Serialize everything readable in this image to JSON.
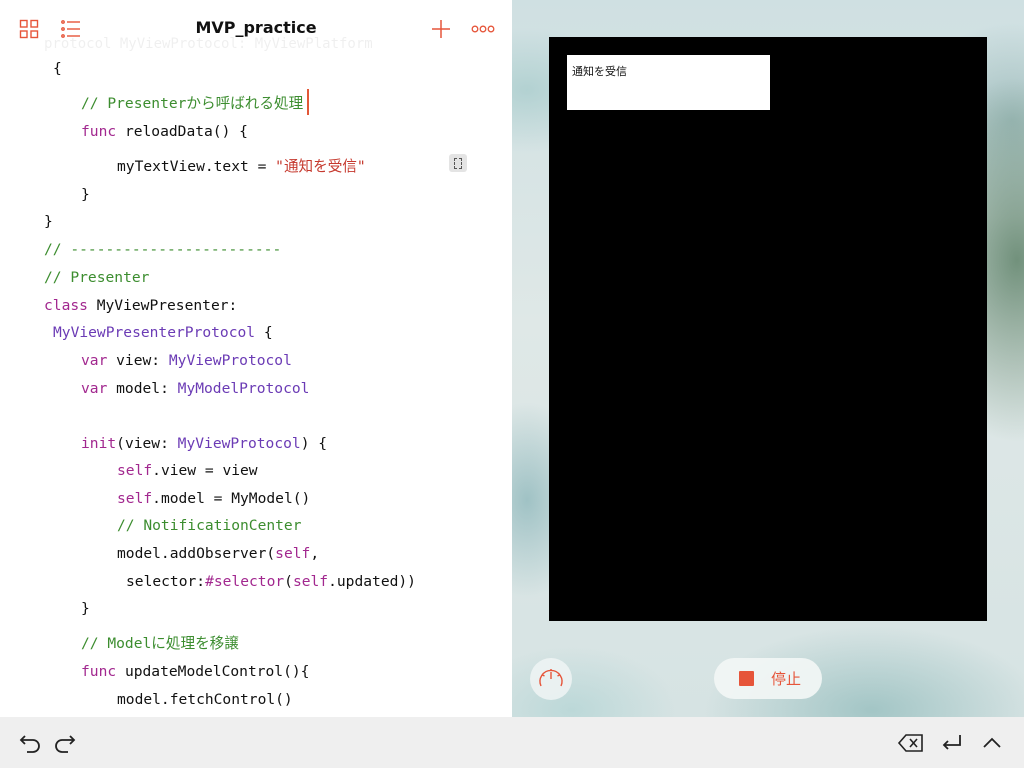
{
  "editor": {
    "title": "MVP_practice",
    "ghost_text": "protocol MyViewProtocol: MyViewPlatform",
    "lines": [
      [
        {
          "t": "{",
          "c": "pl"
        }
      ],
      [
        {
          "t": "// Presenterから呼ばれる処理",
          "c": "cm"
        }
      ],
      [
        {
          "t": "func",
          "c": "kw"
        },
        {
          "t": " reloadData() {",
          "c": "pl"
        }
      ],
      [
        {
          "t": "myTextView.text = ",
          "c": "pl"
        },
        {
          "t": "\"通知を受信\"",
          "c": "st"
        }
      ],
      [
        {
          "t": "}",
          "c": "pl"
        }
      ],
      [
        {
          "t": "}",
          "c": "pl"
        }
      ],
      [
        {
          "t": "// ------------------------",
          "c": "cm"
        }
      ],
      [
        {
          "t": "// Presenter",
          "c": "cm"
        }
      ],
      [
        {
          "t": "class",
          "c": "kw"
        },
        {
          "t": " MyViewPresenter:",
          "c": "pl"
        }
      ],
      [
        {
          "t": "MyViewPresenterProtocol",
          "c": "ty"
        },
        {
          "t": " {",
          "c": "pl"
        }
      ],
      [
        {
          "t": "var",
          "c": "kw"
        },
        {
          "t": " view: ",
          "c": "pl"
        },
        {
          "t": "MyViewProtocol",
          "c": "ty"
        }
      ],
      [
        {
          "t": "var",
          "c": "kw"
        },
        {
          "t": " model: ",
          "c": "pl"
        },
        {
          "t": "MyModelProtocol",
          "c": "ty"
        }
      ],
      [
        {
          "t": "init",
          "c": "kw"
        },
        {
          "t": "(view: ",
          "c": "pl"
        },
        {
          "t": "MyViewProtocol",
          "c": "ty"
        },
        {
          "t": ") {",
          "c": "pl"
        }
      ],
      [
        {
          "t": "self",
          "c": "kw"
        },
        {
          "t": ".view = view",
          "c": "pl"
        }
      ],
      [
        {
          "t": "self",
          "c": "kw"
        },
        {
          "t": ".model = MyModel()",
          "c": "pl"
        }
      ],
      [
        {
          "t": "// NotificationCenter",
          "c": "cm"
        }
      ],
      [
        {
          "t": "model.addObserver(",
          "c": "pl"
        },
        {
          "t": "self",
          "c": "kw"
        },
        {
          "t": ",",
          "c": "pl"
        }
      ],
      [
        {
          "t": "selector:",
          "c": "pl"
        },
        {
          "t": "#selector",
          "c": "kw"
        },
        {
          "t": "(",
          "c": "pl"
        },
        {
          "t": "self",
          "c": "kw"
        },
        {
          "t": ".updated))",
          "c": "pl"
        }
      ],
      [
        {
          "t": "}",
          "c": "pl"
        }
      ],
      [
        {
          "t": "// Modelに処理を移譲",
          "c": "cm"
        }
      ],
      [
        {
          "t": "func",
          "c": "kw"
        },
        {
          "t": " updateModelControl(){",
          "c": "pl"
        }
      ],
      [
        {
          "t": "model.fetchControl()",
          "c": "pl"
        }
      ]
    ]
  },
  "toolbar_icons": [
    "grid-icon",
    "list-icon",
    "plus-icon",
    "more-icon"
  ],
  "preview": {
    "textview_text": "通知を受信",
    "stop_label": "停止"
  },
  "bottom_bar_icons": [
    "undo-icon",
    "redo-icon",
    "delete-icon",
    "return-icon",
    "chevron-up-icon"
  ],
  "colors": {
    "accent": "#e6553a",
    "keyword": "#a2288f",
    "type": "#6b3bb5",
    "comment": "#3c8d2f",
    "string": "#c6392e"
  }
}
